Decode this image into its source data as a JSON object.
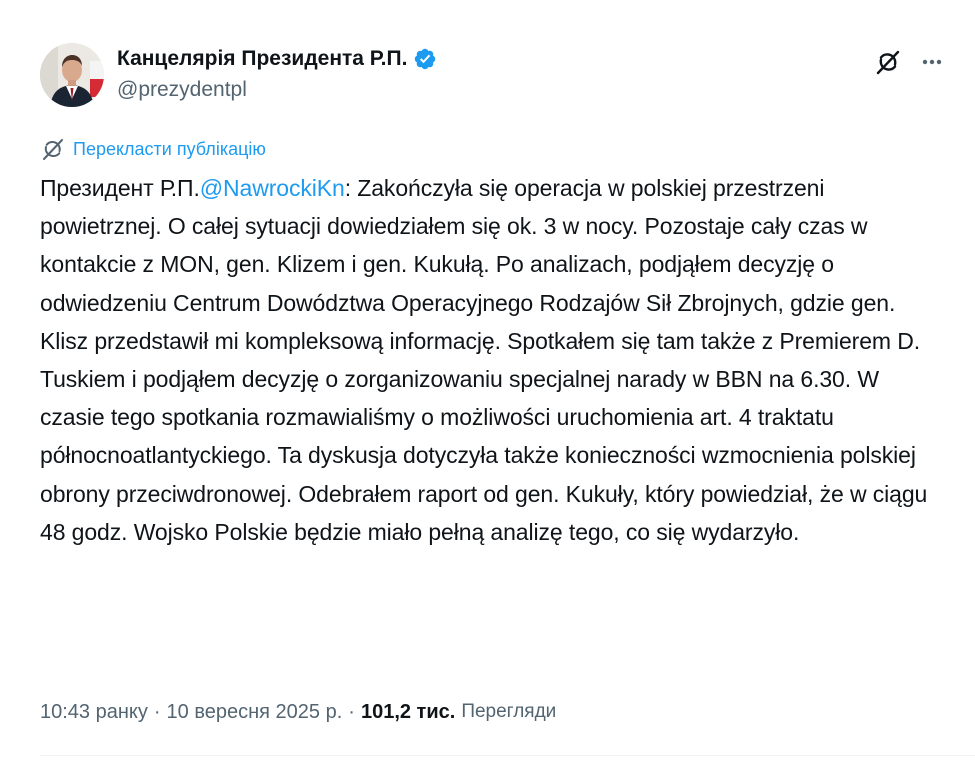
{
  "author": {
    "display_name": "Канцелярія Президента Р.П.",
    "handle": "@prezydentpl",
    "verified": true,
    "verified_color": "#1d9bf0"
  },
  "actions": {
    "grok_icon": "grok-icon",
    "more_icon": "more-options-icon"
  },
  "translate": {
    "label": "Перекласти публікацію",
    "icon": "globe-translate-icon",
    "color": "#1d9bf0"
  },
  "tweet": {
    "prefix": "Президент Р.П.",
    "mention": "@NawrockiKn",
    "body": ": Zakończyła się operacja w polskiej przestrzeni powietrznej. O całej sytuacji dowiedziałem się ok. 3 w nocy. Pozostaje cały czas w kontakcie z MON, gen. Klizem i gen. Kukułą. Po analizach, podjąłem decyzję o odwiedzeniu Centrum Dowództwa Operacyjnego Rodzajów Sił Zbrojnych, gdzie gen. Klisz przedstawił mi kompleksową informację. Spotkałem się tam także z Premierem D. Tuskiem i podjąłem decyzję o zorganizowaniu specjalnej narady w BBN na 6.30. W czasie tego spotkania rozmawialiśmy o możliwości uruchomienia art. 4 traktatu północnoatlantyckiego. Ta dyskusja dotyczyła także konieczności wzmocnienia polskiej obrony przeciwdronowej. Odebrałem raport od gen. Kukuły, który powiedział, że w ciągu 48 godz. Wojsko Polskie będzie miało pełną analizę tego, co się wydarzyło."
  },
  "meta": {
    "time": "10:43 ранку",
    "separator": "·",
    "date": "10 вересня 2025 р.",
    "views_count": "101,2 тис.",
    "views_label": "Перегляди"
  },
  "colors": {
    "text": "#0f1419",
    "secondary": "#536471",
    "accent": "#1d9bf0"
  }
}
